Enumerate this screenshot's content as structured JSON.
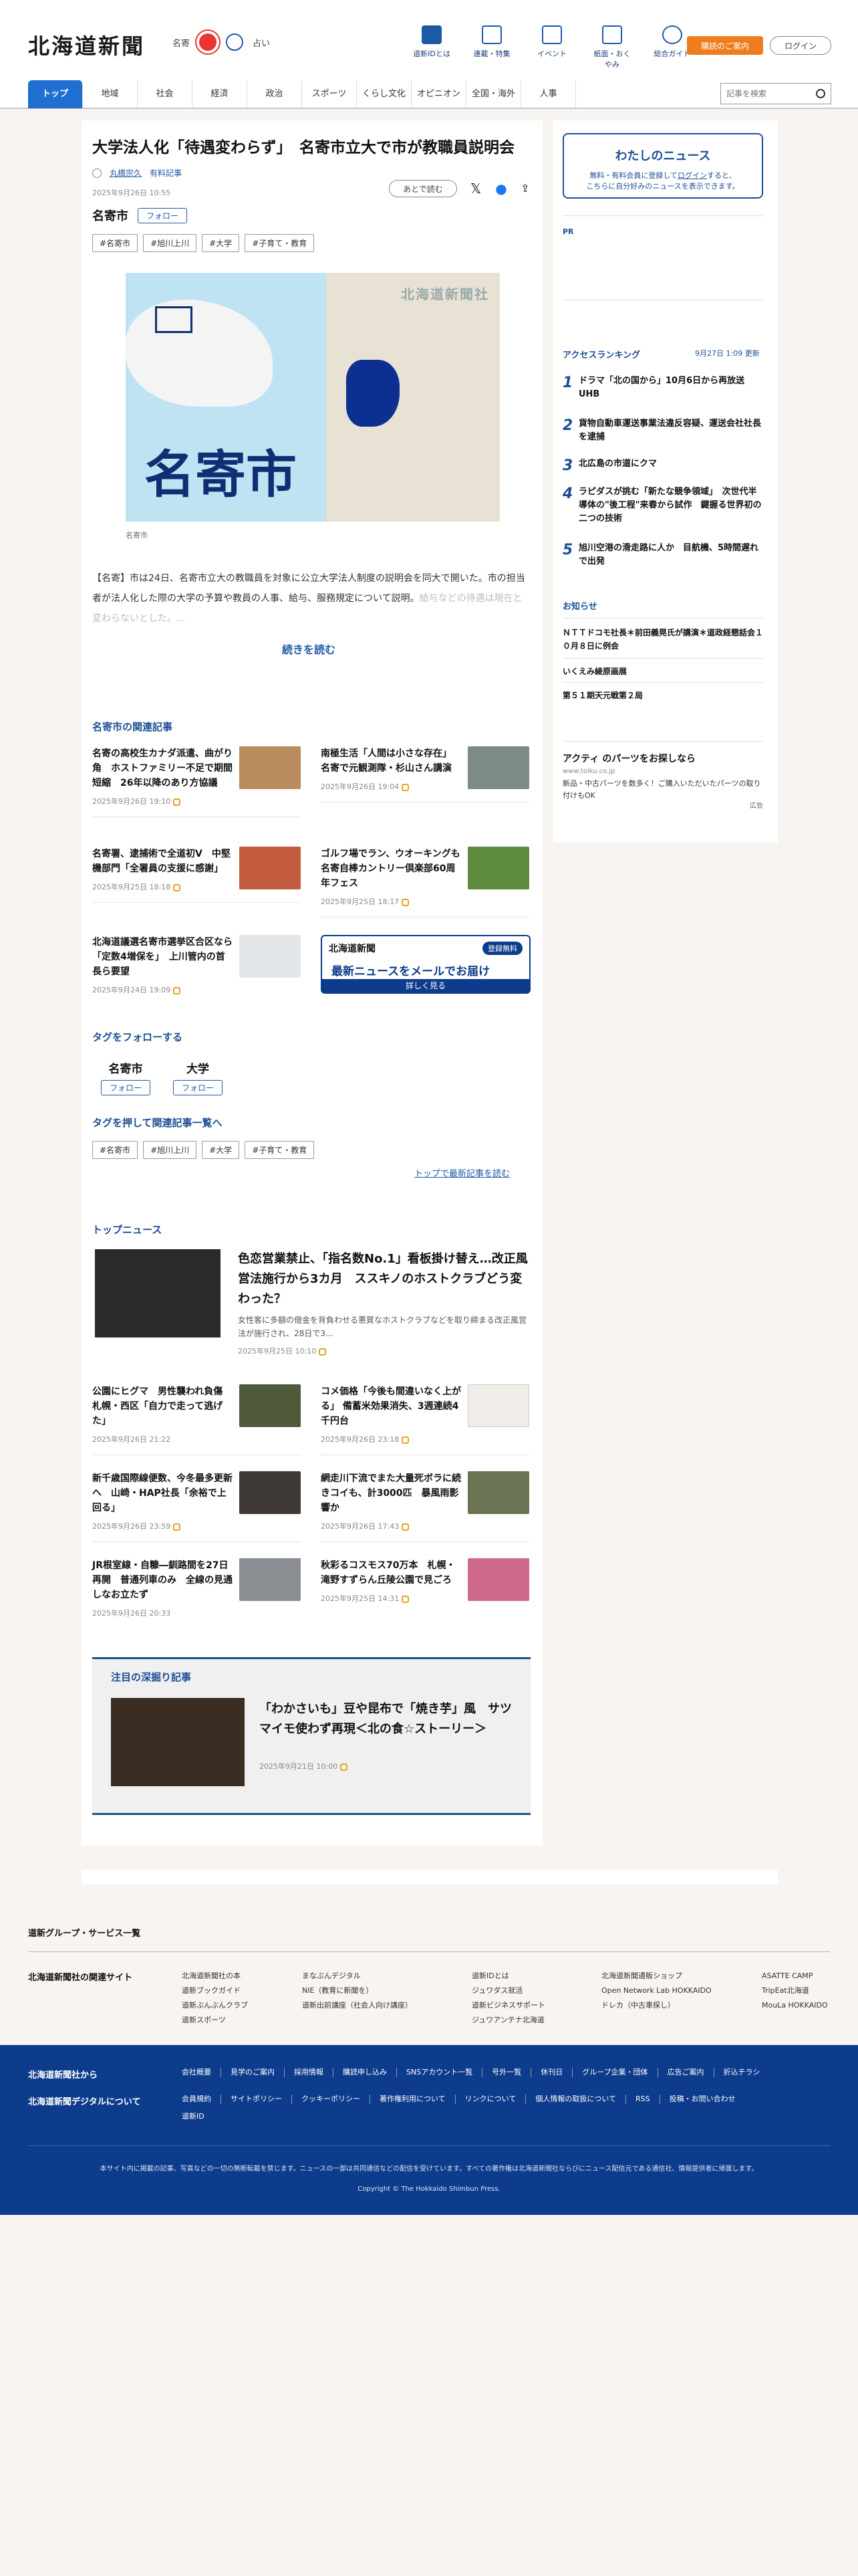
{
  "header": {
    "logo": "北海道新聞",
    "region": "名寄",
    "fortune": "占い",
    "icons": [
      {
        "label": "道新IDとは",
        "name": "book-icon"
      },
      {
        "label": "連載・特集",
        "name": "flag-icon"
      },
      {
        "label": "イベント",
        "name": "calendar-icon"
      },
      {
        "label": "紙面・おくやみ",
        "name": "newspaper-icon"
      },
      {
        "label": "総合ガイド",
        "name": "help-icon"
      }
    ],
    "member_btn": "購読のご案内",
    "login_btn": "ログイン",
    "search_placeholder": "記事を検索"
  },
  "nav": [
    "トップ",
    "地域",
    "社会",
    "経済",
    "政治",
    "スポーツ",
    "くらし文化",
    "オピニオン",
    "全国・海外",
    "人事"
  ],
  "article": {
    "title": "大学法人化「待遇変わらず」　名寄市立大で市が教職員説明会",
    "author": "丸橋宗久",
    "author_tag": "有料記事",
    "date": "2025年9月26日 10:55",
    "later": "あとで読む",
    "topic": "名寄市",
    "follow": "フォロー",
    "tags": [
      "#名寄市",
      "#旭川上川",
      "#大学",
      "#子育て・教育"
    ],
    "image_label": "名寄市",
    "image_watermark": "北海道新聞社",
    "caption": "名寄市",
    "lead": "【名寄】市は24日、名寄市立大の教職員を対象に公立大学法人制度の説明会を同大で開いた。市の担当者が法人化した際の大学の予算や教員の人事、給与、服務規定について説明。",
    "lead_faded": "給与などの待遇は現在と変わらないとした。...",
    "readmore": "続きを読む"
  },
  "related": {
    "title": "名寄市の関連記事",
    "items": [
      {
        "t": "名寄の高校生カナダ派遣、曲がり角　ホストファミリー不足で期間短縮　26年以降のあり方協議",
        "d": "2025年9月26日 19:10"
      },
      {
        "t": "南極生活「人間は小さな存在」 名寄で元観測隊・杉山さん講演",
        "d": "2025年9月26日 19:04"
      },
      {
        "t": "名寄署、逮捕術で全道初V　中堅機部門「全署員の支援に感謝」",
        "d": "2025年9月25日 18:18"
      },
      {
        "t": "ゴルフ場でラン、ウオーキングも　名寄自棒カントリー倶楽部60周年フェス",
        "d": "2025年9月25日 18:17"
      },
      {
        "t": "北海道議選名寄市選挙区合区なら「定数4増保を」　上川管内の首長ら要望",
        "d": "2025年9月24日 19:09"
      }
    ],
    "banner": {
      "l1": "北海道新聞",
      "free": "登録無料",
      "l2": "最新ニュースをメールでお届け",
      "btn": "詳しく見る"
    }
  },
  "follow_tags": {
    "title": "タグをフォローする",
    "items": [
      "名寄市",
      "大学"
    ],
    "follow": "フォロー"
  },
  "tag_list": {
    "title": "タグを押して関連記事一覧へ",
    "more": "トップで最新記事を読む"
  },
  "top_news": {
    "title": "トップニュース",
    "lead": {
      "t": "色恋営業禁止、「指名数No.1」看板掛け替え…改正風営法施行から3カ月　ススキノのホストクラブどう変わった？",
      "s": "女性客に多額の借金を背負わせる悪質なホストクラブなどを取り締まる改正風営法が施行され、28日で3...",
      "d": "2025年9月25日 10:10"
    },
    "items": [
      {
        "t": "公園にヒグマ　男性襲われ負傷　札幌・西区「自力で走って逃げた」",
        "d": "2025年9月26日 21:22"
      },
      {
        "t": "コメ価格「今後も間違いなく上がる」 備蓄米効果消失、3週連続4千円台",
        "d": "2025年9月26日 23:18"
      },
      {
        "t": "新千歳国際線便数、今冬最多更新へ　山崎・HAP社長「余裕で上回る」",
        "d": "2025年9月26日 23:59"
      },
      {
        "t": "網走川下流でまた大量死ボラに続きコイも、計3000匹　暴風雨影響か",
        "d": "2025年9月26日 17:43"
      },
      {
        "t": "JR根室線・自糠―釧路間を27日再開　普通列車のみ　全線の見通しなお立たず",
        "d": "2025年9月26日 20:33"
      },
      {
        "t": "秋彩るコスモス70万本　札幌・滝野すずらん丘陵公園で見ごろ",
        "d": "2025年9月25日 14:31"
      }
    ]
  },
  "feature": {
    "title": "注目の深掘り記事",
    "t": "「わかさいも」豆や昆布で「焼き芋」風　サツマイモ使わず再現＜北の食☆ストーリー＞",
    "d": "2025年9月21日 10:00"
  },
  "sidebar": {
    "my_news_title": "わたしのニュース",
    "my_news_s1": "無料・有料会員に登録して",
    "my_news_login": "ログイン",
    "my_news_s2": "すると、",
    "my_news_s3": "こちらに自分好みのニュースを表示できます。",
    "pr": "PR",
    "ranking_title": "アクセスランキング",
    "ranking_updated": "9月27日 1:09 更新",
    "ranking": [
      {
        "n": "1",
        "t": "ドラマ「北の国から」10月6日から再放送　UHB"
      },
      {
        "n": "2",
        "t": "貨物自動車運送事業法違反容疑、運送会社社長を逮捕"
      },
      {
        "n": "3",
        "t": "北広島の市道にクマ"
      },
      {
        "n": "4",
        "t": "ラピダスが挑む「新たな競争領域」　次世代半導体の\"後工程\"来春から試作　鍵握る世界初の二つの技術"
      },
      {
        "n": "5",
        "t": "旭川空港の滑走路に人か　目航機、5時間遅れで出発"
      }
    ],
    "notice_title": "お知らせ",
    "notices": [
      "ＮＴＴドコモ社長＊前田義晃氏が講演＊道政経懇話会１０月８日に例会",
      "いくえみ綾原画展",
      "第５１期天元戦第２局"
    ],
    "ad": {
      "t": "アクティ のパーツをお探しなら",
      "u": "www.toiku.co.jp",
      "s": "新品・中古パーツを数多く！ご購入いただいたパーツの取り付けもOK",
      "mk": "広告"
    }
  },
  "group": {
    "title": "道新グループ・サービス一覧",
    "label": "北海道新聞社の関連サイト",
    "cols": [
      [
        "北海道新聞社の本",
        "道新ブックガイド",
        "道新ぶんぶんクラブ",
        "道新スポーツ"
      ],
      [
        "まなぶんデジタル",
        "NIE（教育に新聞を）",
        "道新出前講座（社会人向け講座）"
      ],
      [
        "道新IDとは",
        "ジュワダス就活",
        "道新ビジネスサポート",
        "ジュワアンテナ北海道"
      ],
      [
        "北海道新聞通販ショップ",
        "Open Network Lab HOKKAIDO",
        "ドレカ（中古車探し）"
      ],
      [
        "ASATTE CAMP",
        "TripEat北海道",
        "MouLa HOKKAIDO"
      ]
    ]
  },
  "footer": {
    "from": "北海道新聞社から",
    "digital": "北海道新聞デジタルについて",
    "links1": [
      "会社概要",
      "見学のご案内",
      "採用情報",
      "購読申し込み",
      "SNSアカウント一覧",
      "号外一覧",
      "休刊日",
      "グループ企業・団体",
      "広告ご案内",
      "折込チラシ"
    ],
    "links2": [
      "会員規約",
      "サイトポリシー",
      "クッキーポリシー",
      "著作権利用について",
      "リンクについて",
      "個人情報の取扱について",
      "RSS",
      "投稿・お問い合わせ"
    ],
    "links3": [
      "道新ID"
    ],
    "note": "本サイト内に掲載の記事、写真などの一切の無断転載を禁じます。ニュースの一部は共同通信などの配信を受けています。すべての著作権は北海道新聞社ならびにニュース配信元である通信社、情報提供者に帰属します。",
    "copy": "Copyright © The Hokkaido Shimbun Press."
  }
}
